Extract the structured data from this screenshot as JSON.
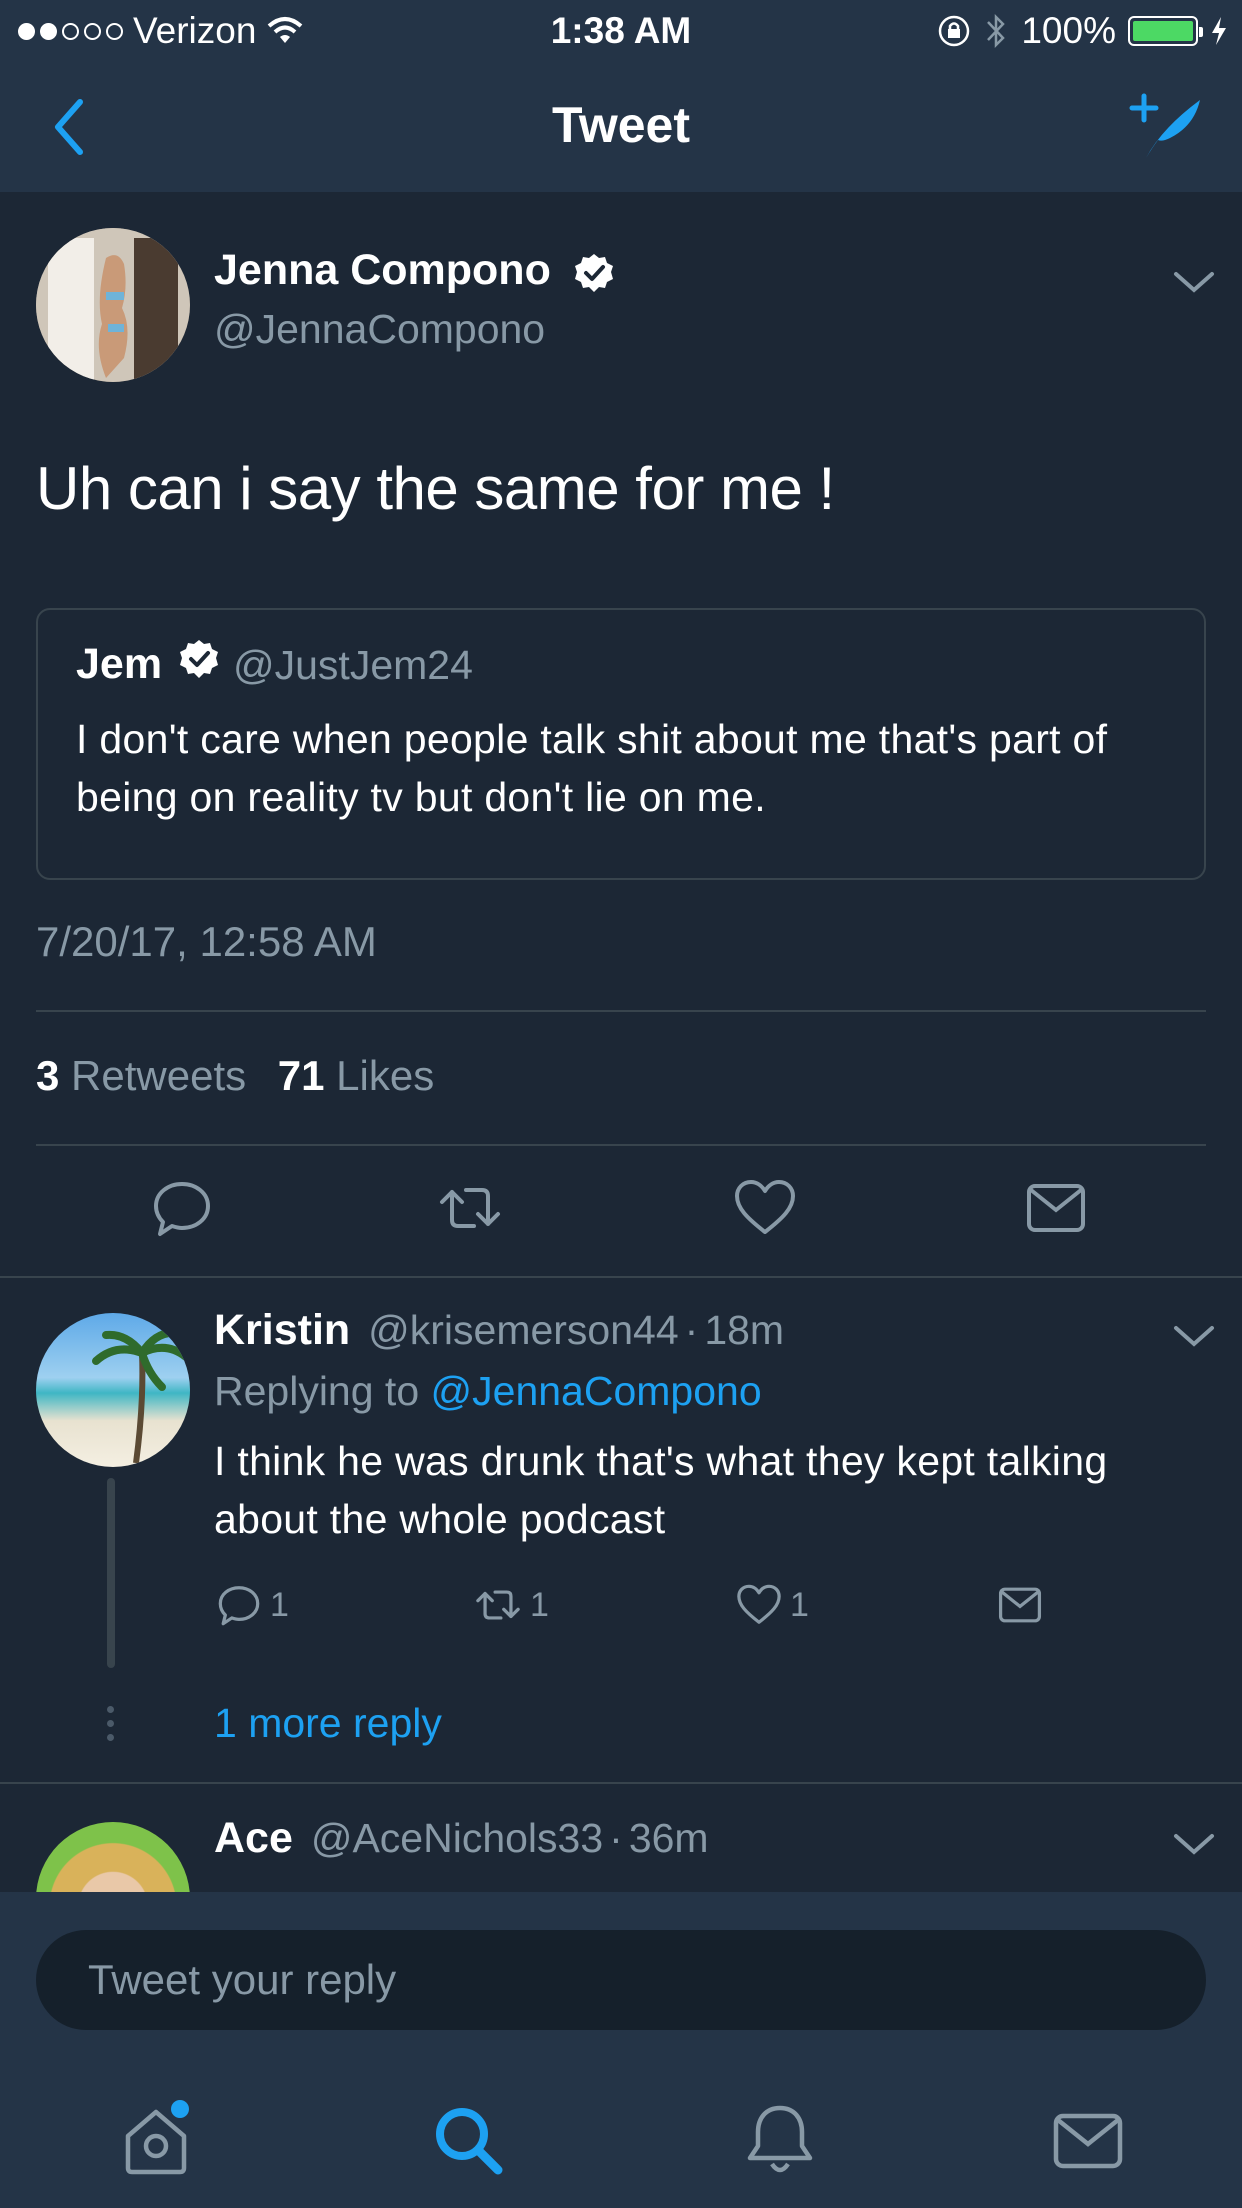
{
  "status_bar": {
    "carrier": "Verizon",
    "time": "1:38 AM",
    "battery": "100%",
    "signal_bars": 2
  },
  "nav": {
    "title": "Tweet"
  },
  "tweet": {
    "name": "Jenna Compono",
    "handle": "@JennaCompono",
    "text": "Uh can i say the same for me !",
    "quote": {
      "name": "Jem",
      "handle": "@JustJem24",
      "text": "I don't care when people talk shit about me that's part of being on reality tv but don't lie on me."
    },
    "timestamp": "7/20/17, 12:58 AM",
    "retweet_count": "3",
    "retweet_label": "Retweets",
    "like_count": "71",
    "like_label": "Likes"
  },
  "replies": [
    {
      "name": "Kristin",
      "handle": "@krisemerson44",
      "dot": "·",
      "time": "18m",
      "replying_prefix": "Replying to",
      "replying_to": "@JennaCompono",
      "text": "I think he was drunk that's what they kept talking about the whole podcast",
      "reply_count": "1",
      "retweet_count": "1",
      "like_count": "1",
      "more_replies": "1 more reply"
    },
    {
      "name": "Ace",
      "handle": "@AceNichols33",
      "dot": "·",
      "time": "36m"
    }
  ],
  "compose": {
    "placeholder": "Tweet your reply"
  },
  "colors": {
    "background": "#1c2735",
    "bar": "#243447",
    "accent": "#1da1f2",
    "secondary_text": "#8899a6",
    "divider": "#38444d"
  },
  "icons": [
    "back-chevron-icon",
    "compose-tweet-icon",
    "verified-badge-icon",
    "chevron-down-icon",
    "reply-icon",
    "retweet-icon",
    "like-icon",
    "direct-message-icon",
    "home-icon",
    "search-icon",
    "notifications-icon",
    "messages-icon"
  ]
}
